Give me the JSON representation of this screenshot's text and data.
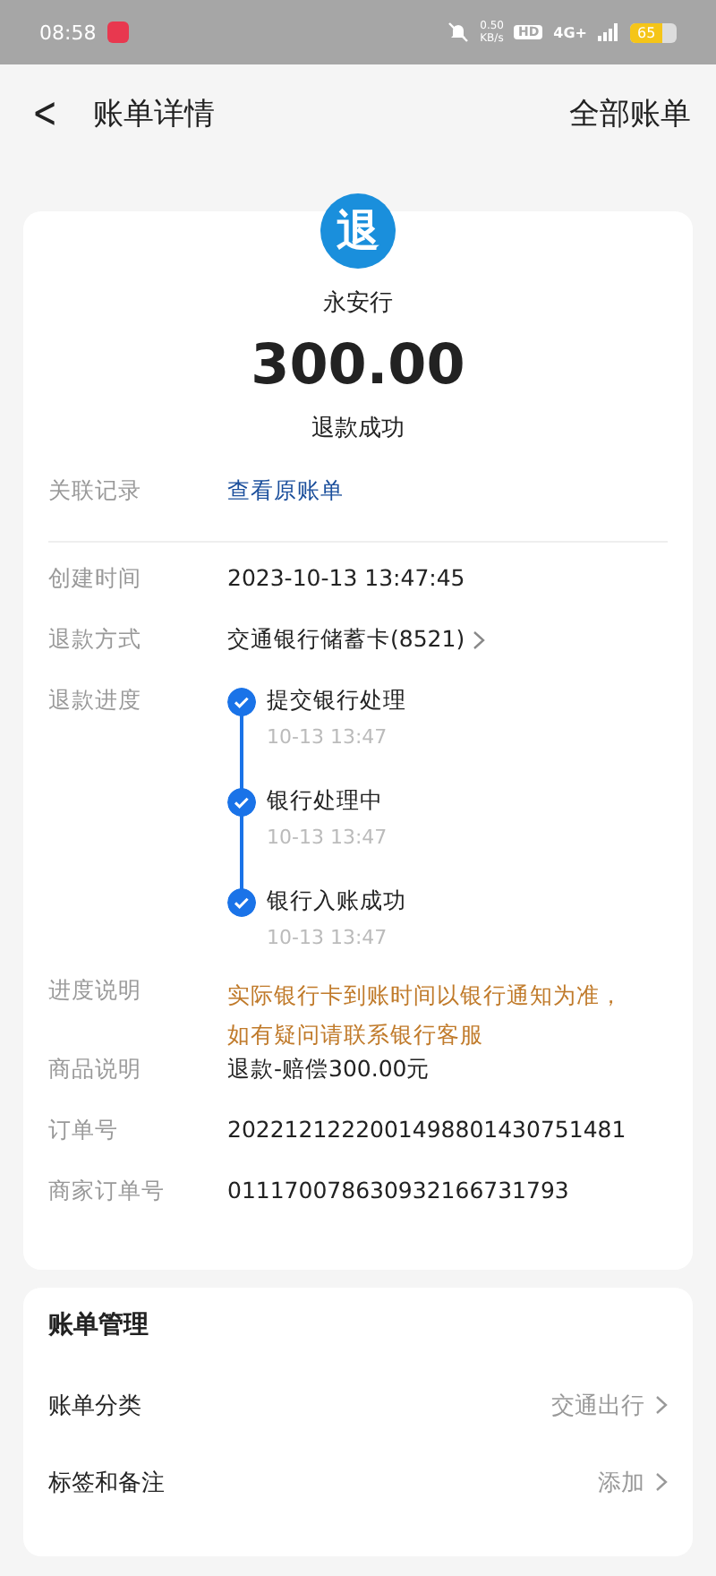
{
  "status_bar": {
    "time": "08:58",
    "net_speed": "0.50",
    "net_unit": "KB/s",
    "hd": "HD",
    "network": "4G+",
    "battery": "65"
  },
  "header": {
    "back": "<",
    "title": "账单详情",
    "action": "全部账单"
  },
  "summary": {
    "icon_text": "退",
    "merchant": "永安行",
    "amount": "300.00",
    "status": "退款成功"
  },
  "details": [
    {
      "kind": "link",
      "label": "关联记录",
      "value": "查看原账单"
    },
    {
      "kind": "divider"
    },
    {
      "kind": "text",
      "label": "创建时间",
      "value": "2023-10-13 13:47:45"
    },
    {
      "kind": "arrow",
      "label": "退款方式",
      "value": "交通银行储蓄卡(8521)"
    },
    {
      "kind": "timeline",
      "label": "退款进度",
      "steps": [
        {
          "title": "提交银行处理",
          "time": "10-13 13:47",
          "done": true
        },
        {
          "title": "银行处理中",
          "time": "10-13 13:47",
          "done": true
        },
        {
          "title": "银行入账成功",
          "time": "10-13 13:47",
          "done": true
        }
      ]
    },
    {
      "kind": "notice",
      "label": "进度说明",
      "lines": [
        "实际银行卡到账时间以银行通知为准，",
        "如有疑问请联系银行客服"
      ]
    },
    {
      "kind": "text",
      "label": "商品说明",
      "value": "退款-赔偿300.00元"
    },
    {
      "kind": "text",
      "label": "订单号",
      "value": "2022121222001498801430751481"
    },
    {
      "kind": "text",
      "label": "商家订单号",
      "value": "011170078630932166731793"
    }
  ],
  "management": {
    "title": "账单管理",
    "items": [
      {
        "label": "账单分类",
        "value": "交通出行"
      },
      {
        "label": "标签和备注",
        "value": "添加"
      }
    ]
  }
}
